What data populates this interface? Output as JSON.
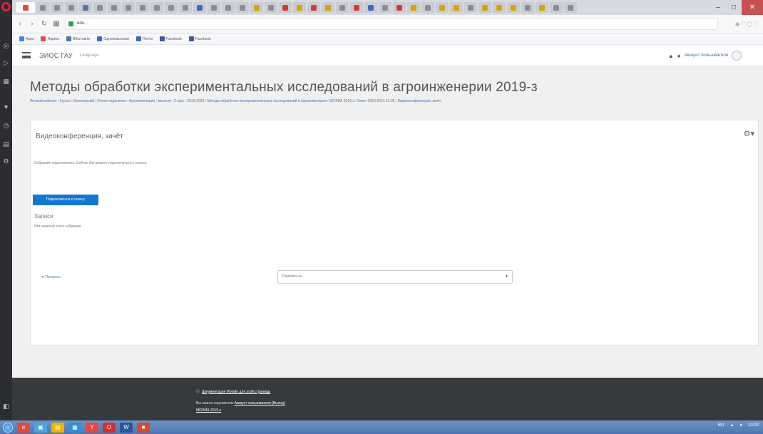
{
  "browser": {
    "url_host": "edu.",
    "url_rest": "...",
    "tabs": [
      {
        "color": "#e8483c"
      },
      {
        "color": "#8a8d94"
      },
      {
        "color": "#8a8d94"
      },
      {
        "color": "#8a8d94"
      },
      {
        "color": "#5b6fb3"
      },
      {
        "color": "#8a8d94"
      },
      {
        "color": "#8a8d94"
      },
      {
        "color": "#8a8d94"
      },
      {
        "color": "#8a8d94"
      },
      {
        "color": "#8a8d94"
      },
      {
        "color": "#8a8d94"
      },
      {
        "color": "#8a8d94"
      },
      {
        "color": "#3b6cc4"
      },
      {
        "color": "#8a8d94"
      },
      {
        "color": "#8a8d94"
      },
      {
        "color": "#8a8d94"
      },
      {
        "color": "#d9a400"
      },
      {
        "color": "#8a8d94"
      },
      {
        "color": "#d63a2f"
      },
      {
        "color": "#d9a400"
      },
      {
        "color": "#d63a2f"
      },
      {
        "color": "#d9a400"
      },
      {
        "color": "#8a8d94"
      },
      {
        "color": "#d63a2f"
      },
      {
        "color": "#3b6cc4"
      },
      {
        "color": "#8a8d94"
      },
      {
        "color": "#d63a2f"
      },
      {
        "color": "#d9a400"
      },
      {
        "color": "#8a8d94"
      },
      {
        "color": "#d9a400"
      },
      {
        "color": "#d9a400"
      },
      {
        "color": "#8a8d94"
      },
      {
        "color": "#d9a400"
      },
      {
        "color": "#d9a400"
      },
      {
        "color": "#d9a400"
      },
      {
        "color": "#8a8d94"
      },
      {
        "color": "#d9a400"
      },
      {
        "color": "#8a8d94"
      },
      {
        "color": "#8a8d94"
      }
    ],
    "bookmarks": [
      {
        "label": "Apps",
        "color": "#4285f4"
      },
      {
        "label": "Яндекс",
        "color": "#e8483c"
      },
      {
        "label": "ВКонтакте",
        "color": "#4a76a8"
      },
      {
        "label": "Одноклассники",
        "color": "#3b6cc4"
      },
      {
        "label": "Почта",
        "color": "#3b6cc4"
      },
      {
        "label": "Facebook",
        "color": "#3b5998"
      },
      {
        "label": "Facebook",
        "color": "#3b5998"
      }
    ]
  },
  "navbar": {
    "brand": "ЭИОС ГАУ",
    "link": "Language",
    "username": "Аккаунт пользователя"
  },
  "page": {
    "title": "Методы обработки экспериментальных исследований в агроинженерии 2019-з",
    "breadcrumb_items": [
      "Личный кабинет",
      "Курсы",
      "Инженерный",
      "Очное отделение",
      "Агроинженерия",
      "магистр",
      "2 курс",
      "2019-2020",
      "Методы обработки экспериментальных исследований в агроинженерии",
      "МОЭИА 2019-з",
      "Зачет 2020-2021 13.05",
      "Видеоконференция, зачёт"
    ]
  },
  "activity": {
    "title": "Видеоконференция, зачёт",
    "info": "Собрание подготовлено. Сейчас Вы можете подключиться к сеансу.",
    "join_label": "Подключиться к сеансу",
    "recordings_title": "Записи",
    "recordings_empty": "Нет записей этого собрания",
    "prev_link": "◄ Прогресс",
    "jump_placeholder": "Перейти на...",
    "jump_caret": "♦"
  },
  "footer": {
    "doc_link": "Документация Moodle для этой страницы",
    "login_prefix": "Вы зашли под именем",
    "login_user": "Аккаунт пользователя (Выход)",
    "course": "МОЭИА 2019-з"
  },
  "taskbar": {
    "icons": [
      {
        "color": "#e8483c",
        "glyph": "e"
      },
      {
        "color": "#4fa3e0",
        "glyph": "▣"
      },
      {
        "color": "#f0b400",
        "glyph": "▤"
      },
      {
        "color": "#2f8fd8",
        "glyph": "▦"
      },
      {
        "color": "#e8483c",
        "glyph": "Y"
      },
      {
        "color": "#d32f2f",
        "glyph": "O"
      },
      {
        "color": "#2b579a",
        "glyph": "W"
      },
      {
        "color": "#d84a2a",
        "glyph": "■"
      }
    ],
    "tray": [
      "RU",
      "▲",
      "●",
      "10:02"
    ]
  }
}
